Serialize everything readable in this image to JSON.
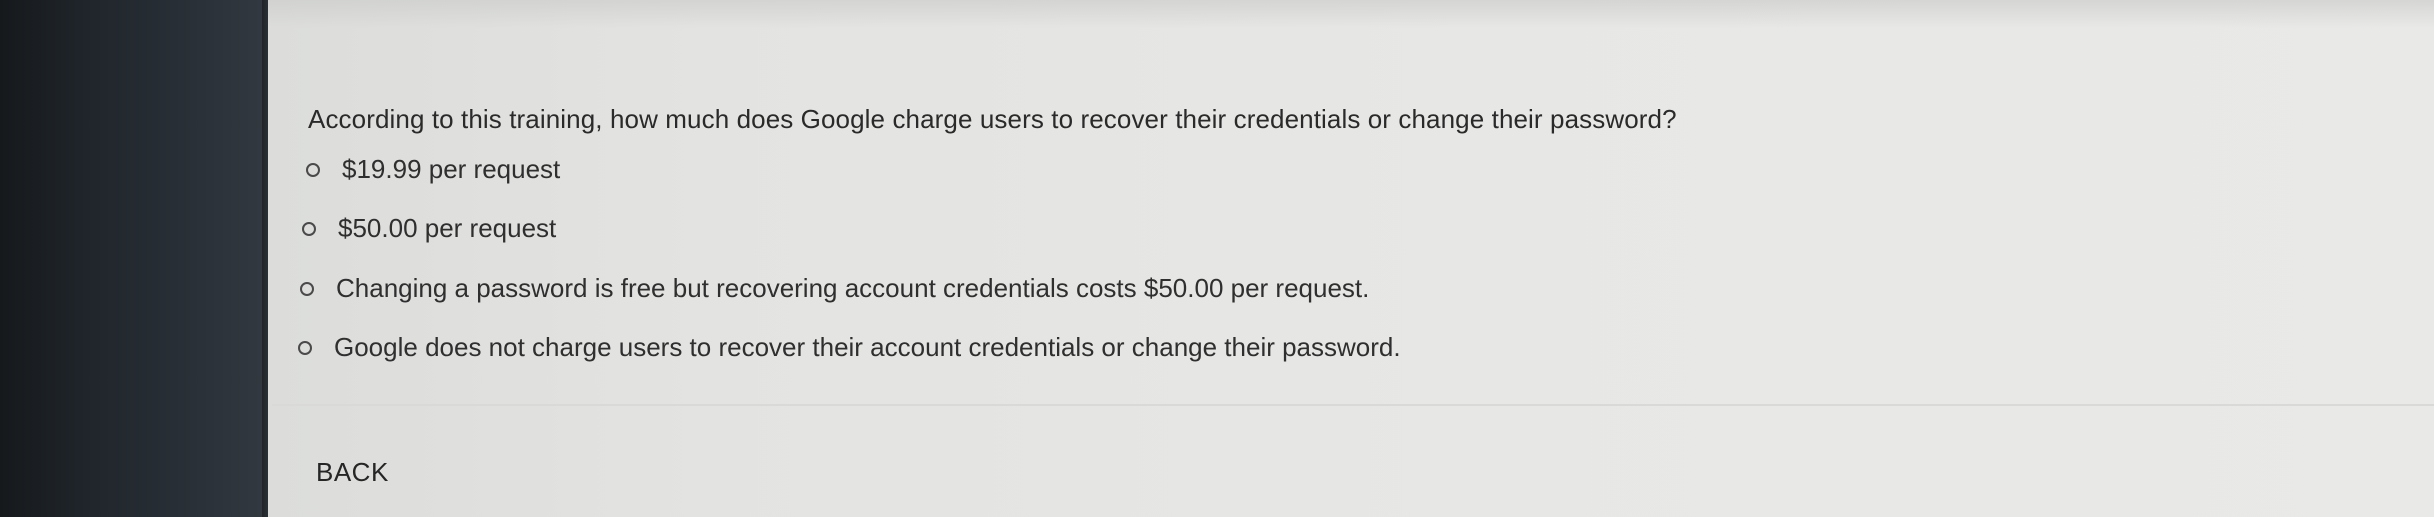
{
  "quiz": {
    "question": "According to this training, how much does Google charge users to recover their credentials or change their password?",
    "options": [
      {
        "label": "$19.99 per request",
        "selected": false
      },
      {
        "label": "$50.00 per request",
        "selected": false
      },
      {
        "label": "Changing a password is free but recovering account credentials costs $50.00 per request.",
        "selected": false
      },
      {
        "label": "Google does not charge users to recover their account credentials or change their password.",
        "selected": false
      }
    ]
  },
  "navigation": {
    "back_label": "BACK"
  },
  "colors": {
    "background": "#e4e4e2",
    "text": "#2a2a2a",
    "bezel": "#20262c"
  }
}
